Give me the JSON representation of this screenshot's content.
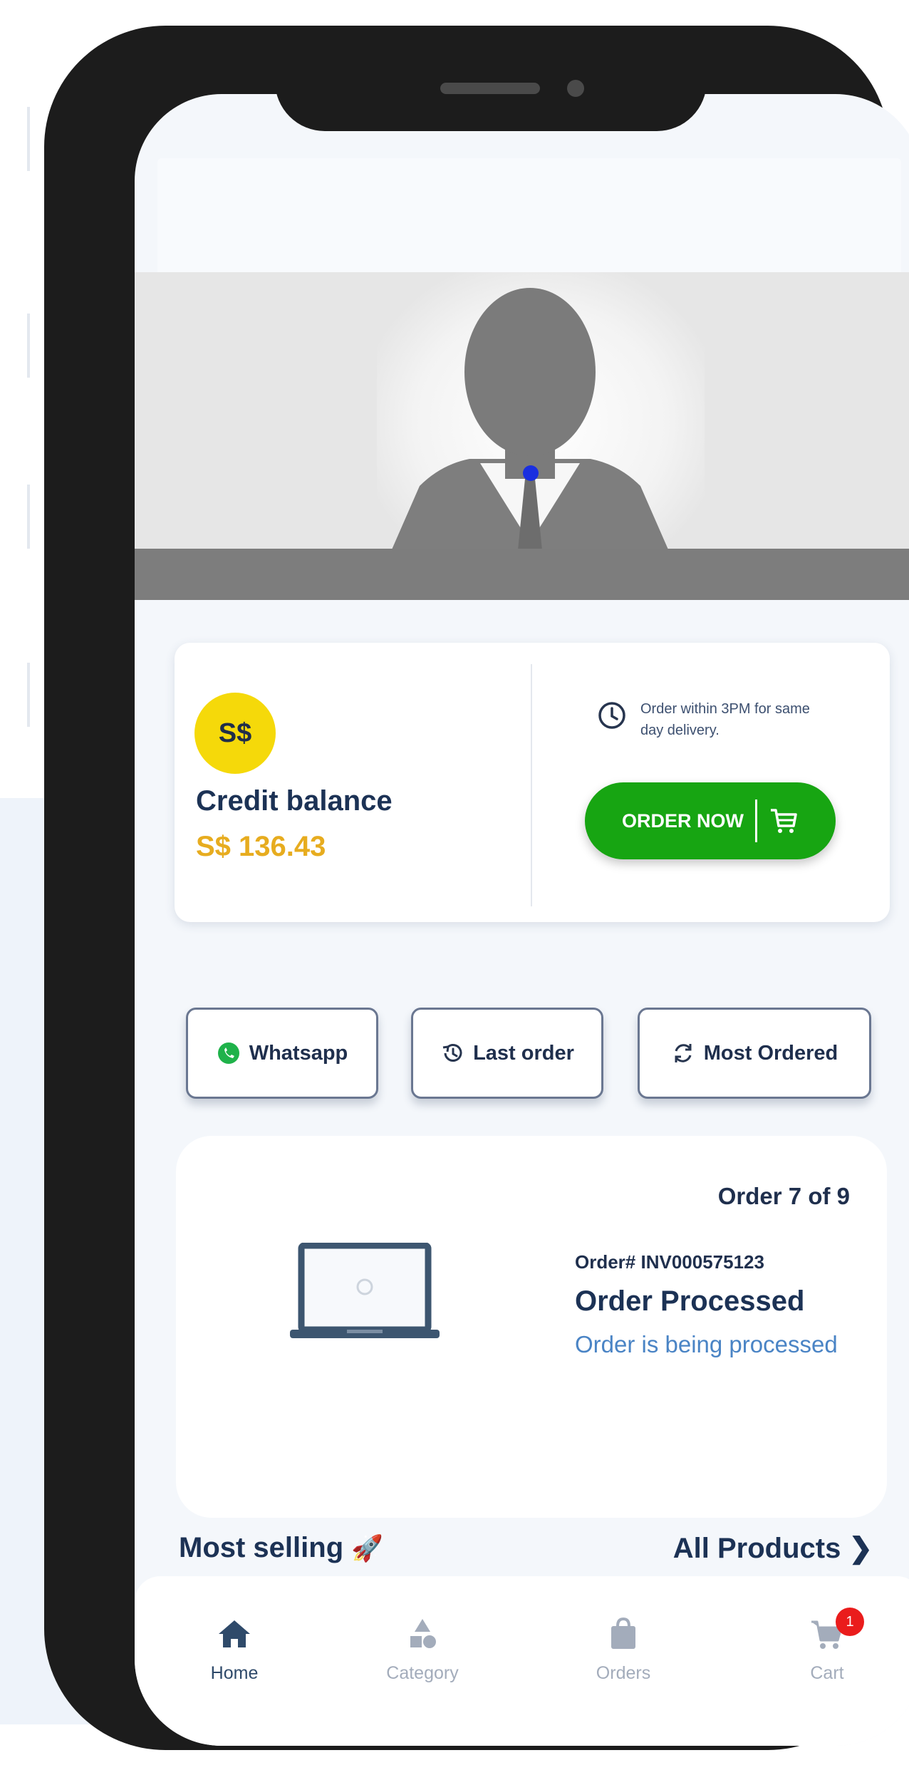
{
  "credit": {
    "currency_symbol": "S$",
    "title": "Credit balance",
    "amount": "S$ 136.43"
  },
  "delivery": {
    "note": "Order within 3PM for same day delivery.",
    "icon": "clock-icon"
  },
  "order_button": {
    "label": "ORDER NOW",
    "icon": "cart-icon",
    "color": "#17a512"
  },
  "quick_actions": [
    {
      "label": "Whatsapp",
      "icon": "whatsapp-icon"
    },
    {
      "label": "Last order",
      "icon": "history-icon"
    },
    {
      "label": "Most Ordered",
      "icon": "refresh-icon"
    }
  ],
  "order_card": {
    "counter": "Order 7  of 9",
    "number": "Order# INV000575123",
    "status": "Order Processed",
    "description": "Order is being processed"
  },
  "section": {
    "title": "Most selling",
    "link": "All Products",
    "link_icon": "chevron-right-icon"
  },
  "nav": {
    "items": [
      {
        "label": "Home",
        "icon": "home-icon",
        "active": true
      },
      {
        "label": "Category",
        "icon": "category-icon",
        "active": false
      },
      {
        "label": "Orders",
        "icon": "orders-bag-icon",
        "active": false
      },
      {
        "label": "Cart",
        "icon": "cart-icon",
        "active": false
      }
    ],
    "cart_badge": "1"
  },
  "colors": {
    "accent_yellow": "#f5d90a",
    "amount_gold": "#e7ac1f",
    "heading_navy": "#1c3255",
    "link_blue": "#4a84c5",
    "badge_red": "#ea1c1c"
  }
}
